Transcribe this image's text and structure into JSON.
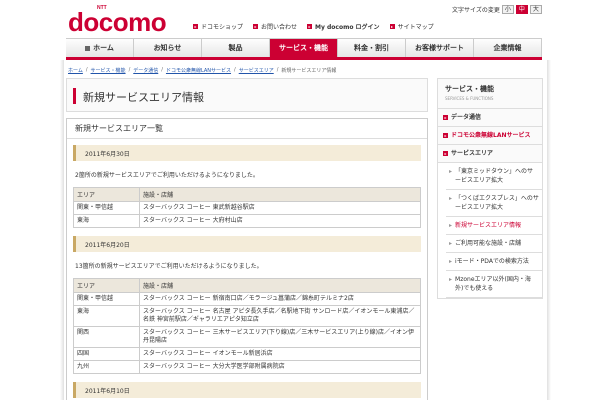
{
  "header": {
    "logo": "docomo",
    "logo_ntt": "NTT",
    "font_size_label": "文字サイズの変更",
    "font_sizes": [
      "小",
      "中",
      "大"
    ],
    "links": [
      "ドコモショップ",
      "お問い合わせ",
      "My docomo ログイン",
      "サイトマップ"
    ]
  },
  "nav": {
    "tabs": [
      "ホーム",
      "お知らせ",
      "製品",
      "サービス・機能",
      "料金・割引",
      "お客様サポート",
      "企業情報"
    ],
    "active_index": 3
  },
  "breadcrumb": {
    "links": [
      "ホーム",
      "サービス・機能",
      "データ通信",
      "ドコモ公衆無線LANサービス",
      "サービスエリア"
    ],
    "current": "新規サービスエリア情報"
  },
  "main": {
    "page_title": "新規サービスエリア情報",
    "section_title": "新規サービスエリア一覧",
    "table_headers": [
      "エリア",
      "施設・店舗"
    ],
    "groups": [
      {
        "date": "2011年6月30日",
        "desc": "2箇所の新規サービスエリアでご利用いただけるようになりました。",
        "rows": [
          {
            "region": "関東・甲信越",
            "stores": "スターバックス コーヒー 東武新越谷駅店"
          },
          {
            "region": "東海",
            "stores": "スターバックス コーヒー 大府村山店"
          }
        ]
      },
      {
        "date": "2011年6月20日",
        "desc": "13箇所の新規サービスエリアでご利用いただけるようになりました。",
        "rows": [
          {
            "region": "関東・甲信越",
            "stores": "スターバックス コーヒー 新宿南口店／モラージュ菖蒲店／錦糸町テルミナ2店"
          },
          {
            "region": "東海",
            "stores": "スターバックス コーヒー 名古屋 アピタ長久手店／名駅地下街 サンロード店／イオンモール東浦店／名鉄 神宮前駅店／ギャラリエアピタ知立店"
          },
          {
            "region": "関西",
            "stores": "スターバックス コーヒー 三木サービスエリア(下り線)店／三木サービスエリア(上り線)店／イオン伊丹昆陽店"
          },
          {
            "region": "四国",
            "stores": "スターバックス コーヒー イオンモール新居浜店"
          },
          {
            "region": "九州",
            "stores": "スターバックス コーヒー 大分大学医学部附属病院店"
          }
        ]
      },
      {
        "date": "2011年6月10日",
        "desc": "",
        "rows": []
      }
    ]
  },
  "sidebar": {
    "title": "サービス・機能",
    "subtitle": "SERVICES & FUNCTIONS",
    "item_data": "データ通信",
    "item_wifi": "ドコモ公衆無線LANサービス",
    "item_area": "サービスエリア",
    "sub_items": [
      "「東京ミッドタウン」へのサービスエリア拡大",
      "「つくばエクスプレス」へのサービスエリア拡大",
      "新規サービスエリア情報",
      "ご利用可能な施設・店舗",
      "iモード・PDAでの検索方法",
      "Mzoneエリア以外(国内・海外)でも使える"
    ],
    "current_index": 2
  },
  "colors": {
    "brand": "#cc0033",
    "date_bar": "#f4ecd9",
    "table_header": "#ece7dc"
  }
}
